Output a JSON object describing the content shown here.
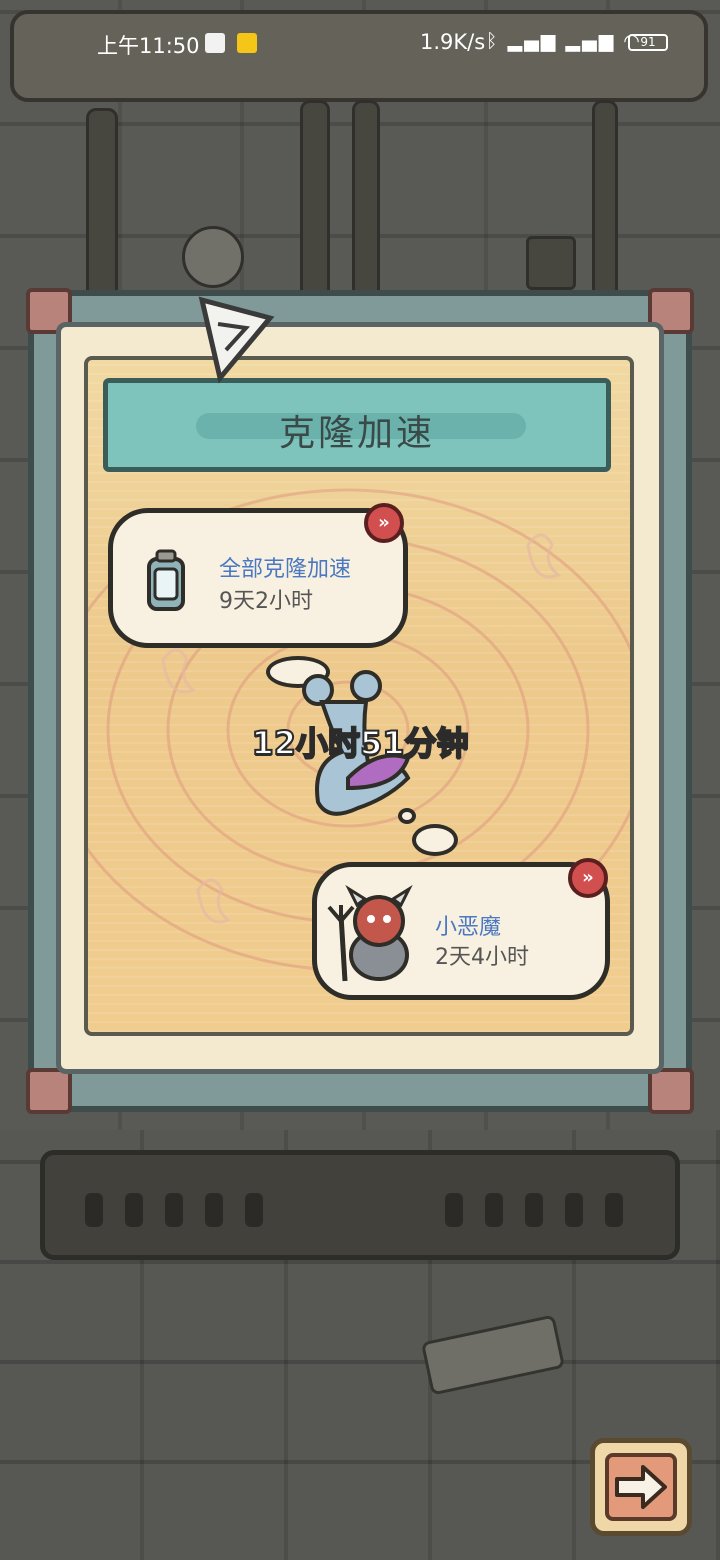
{
  "status_bar": {
    "time": "上午11:50",
    "network_speed": "1.9K/s",
    "battery": "91"
  },
  "dialog": {
    "title": "克隆加速",
    "all_clone": {
      "label": "全部克隆加速",
      "duration": "9天2小时"
    },
    "current_timer": "12小时51分钟",
    "creature": {
      "name": "小恶魔",
      "duration": "2天4小时"
    }
  },
  "colors": {
    "accent_name": "#4a78c2",
    "speedup_button": "#d24f4f",
    "title_banner": "#7fc3bd"
  },
  "icons": [
    "clone-jar-icon",
    "fast-forward-icon",
    "imp-creature-icon",
    "arrow-right-icon",
    "bluetooth-icon",
    "wifi-icon",
    "signal-icon"
  ]
}
